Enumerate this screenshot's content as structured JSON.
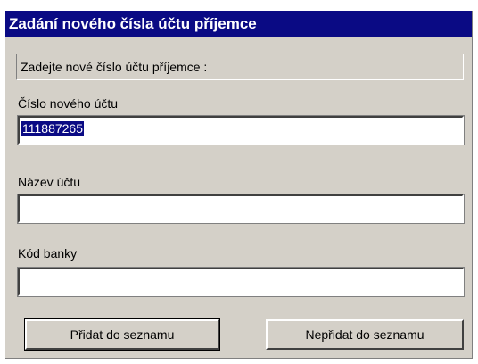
{
  "dialog": {
    "title": "Zadání nového čísla účtu příjemce",
    "prompt": "Zadejte nové číslo účtu příjemce :",
    "fields": {
      "account_number": {
        "label": "Číslo nového účtu",
        "value": "111887265"
      },
      "account_name": {
        "label": "Název účtu",
        "value": ""
      },
      "bank_code": {
        "label": "Kód banky",
        "value": ""
      }
    },
    "buttons": {
      "add": "Přidat do seznamu",
      "dont_add": "Nepřidat do seznamu"
    }
  },
  "colors": {
    "title_bar": "#0a0a84",
    "dialog_bg": "#d4d0c8",
    "selection": "#0a0a84"
  }
}
